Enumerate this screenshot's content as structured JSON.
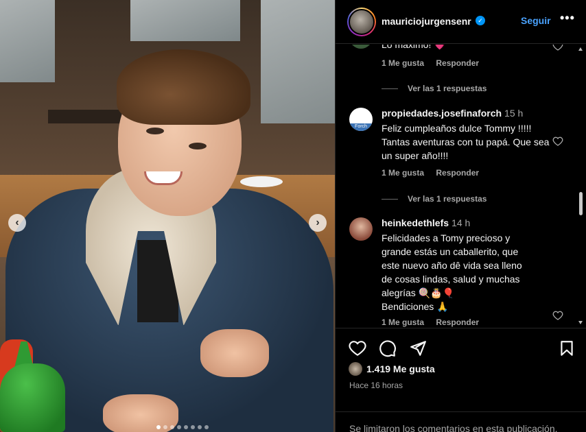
{
  "post": {
    "author": "mauriciojurgensenr",
    "verified": true,
    "follow_label": "Seguir",
    "more_label": "•••",
    "photo_alt": "Photo",
    "carousel": {
      "prev": "‹",
      "next": "›",
      "total_slides": 8,
      "active_slide": 1
    }
  },
  "comments": [
    {
      "user": "",
      "time": "",
      "text": "Lo máximo! 💗",
      "likes_label": "1 Me gusta",
      "reply_label": "Responder",
      "view_replies": "Ver las 1 respuestas"
    },
    {
      "user": "propiedades.josefinaforch",
      "time": "15 h",
      "avatar_text": "Forch",
      "text": "Feliz cumpleaños dulce Tommy !!!!! Tantas aventuras con tu papá. Que sea un super año!!!!",
      "likes_label": "1 Me gusta",
      "reply_label": "Responder",
      "view_replies": "Ver las 1 respuestas"
    },
    {
      "user": "heinkedethlefs",
      "time": "14 h",
      "text_lines": [
        "Felicidades a Tomy precioso y",
        "grande estás un caballerito, que",
        "este nuevo año dê vida sea lleno",
        "de cosas lindas, salud y muchas",
        "alegrías 🍭🎂🎈",
        "Bendiciones 🙏"
      ],
      "likes_label": "1 Me gusta",
      "reply_label": "Responder"
    }
  ],
  "actions": {
    "like_icon": "heart-icon",
    "comment_icon": "comment-icon",
    "share_icon": "send-icon",
    "save_icon": "bookmark-icon"
  },
  "stats": {
    "likes": "1.419 Me gusta",
    "time_ago": "Hace 16 horas"
  },
  "footer": {
    "limited_comments": "Se limitaron los comentarios en esta publicación."
  },
  "colors": {
    "background": "#000000",
    "link_blue": "#4aa3ff",
    "muted": "#a8a8a8",
    "verified": "#0095f6"
  }
}
